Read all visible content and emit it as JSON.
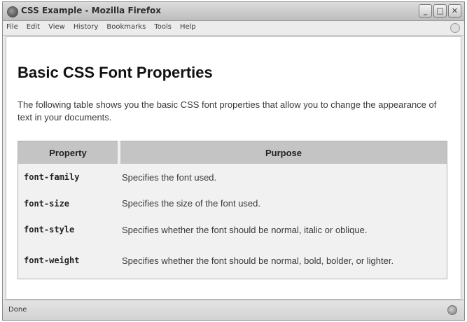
{
  "window": {
    "title": "CSS Example - Mozilla Firefox",
    "buttons": {
      "minimize": "_",
      "maximize": "□",
      "close": "✕"
    }
  },
  "menubar": {
    "items": [
      "File",
      "Edit",
      "View",
      "History",
      "Bookmarks",
      "Tools",
      "Help"
    ]
  },
  "page": {
    "title": "Basic CSS Font Properties",
    "intro": "The following table shows you the basic CSS font properties that allow you to change the appearance of text in your documents.",
    "table": {
      "headers": [
        "Property",
        "Purpose"
      ],
      "rows": [
        {
          "property": "font-family",
          "purpose": "Specifies the font used."
        },
        {
          "property": "font-size",
          "purpose": "Specifies the size of the font used."
        },
        {
          "property": "font-style",
          "purpose": "Specifies whether the font should be normal, italic or oblique."
        },
        {
          "property": "font-weight",
          "purpose": "Specifies whether the font should be normal, bold, bolder, or lighter."
        }
      ]
    }
  },
  "statusbar": {
    "text": "Done"
  },
  "icons": {
    "app": "firefox-icon",
    "throbber": "throbber-icon",
    "status": "status-indicator-icon"
  }
}
